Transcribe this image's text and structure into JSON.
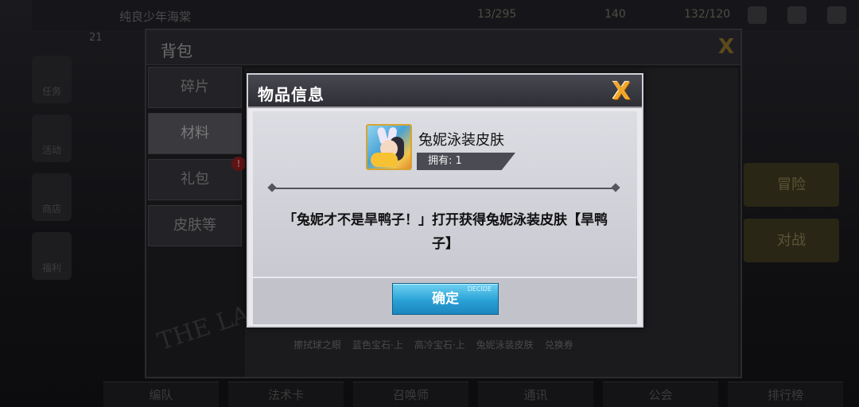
{
  "background": {
    "player_name": "纯良少年海棠",
    "player_level": "21",
    "resources": [
      "13/295",
      "140",
      "132/120"
    ],
    "left_menu": [
      "任务",
      "活动",
      "商店",
      "福利"
    ],
    "right_banners": [
      "冒险",
      "对战"
    ],
    "bottom_nav": [
      "编队",
      "法术卡",
      "召唤师",
      "通讯",
      "公会",
      "排行榜"
    ]
  },
  "bag": {
    "title": "背包",
    "close_glyph": "X",
    "tabs": [
      {
        "label": "碎片"
      },
      {
        "label": "材料"
      },
      {
        "label": "礼包",
        "badge": "!"
      },
      {
        "label": "皮肤等"
      }
    ],
    "grid_labels": [
      "擦拭球之眼",
      "蓝色宝石·上",
      "高冷宝石·上",
      "兔妮泳装皮肤",
      "兑换券"
    ],
    "watermark": "THE LAST CROWN"
  },
  "modal": {
    "title": "物品信息",
    "close_glyph": "X",
    "item_name": "兔妮泳装皮肤",
    "owned_label": "拥有: 1",
    "description": "「兔妮才不是旱鸭子！」打开获得兔妮泳装皮肤【旱鸭子】",
    "confirm_label": "确定",
    "confirm_sub": "DECIDE"
  },
  "colors": {
    "accent_close": "#f2a72a",
    "confirm_button": "#2aa1d6",
    "badge": "#d81e1e"
  }
}
